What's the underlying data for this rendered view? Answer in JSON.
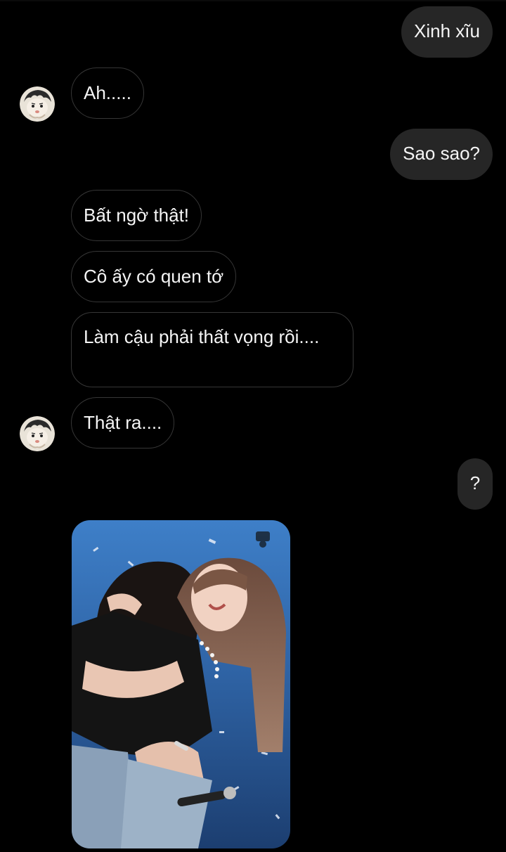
{
  "conversation": {
    "messages": [
      {
        "side": "sent",
        "text": "Xinh xĩu"
      },
      {
        "side": "received",
        "text": "Ah....."
      },
      {
        "side": "sent",
        "text": "Sao sao?"
      },
      {
        "side": "received",
        "text": "Bất ngờ thật!"
      },
      {
        "side": "received",
        "text": "Cô ấy có quen tớ"
      },
      {
        "side": "received",
        "text": "Làm cậu phải thất vọng rồi...."
      },
      {
        "side": "received",
        "text": "Thật ra...."
      },
      {
        "side": "sent",
        "text": "?"
      }
    ],
    "photo": {
      "icon": "shared-photo"
    },
    "avatar": {
      "icon": "cartoon-avatar-icon"
    }
  },
  "colors": {
    "background": "#000000",
    "sent_bubble": "#262626",
    "received_border": "#363636",
    "text": "#f5f5f5"
  }
}
